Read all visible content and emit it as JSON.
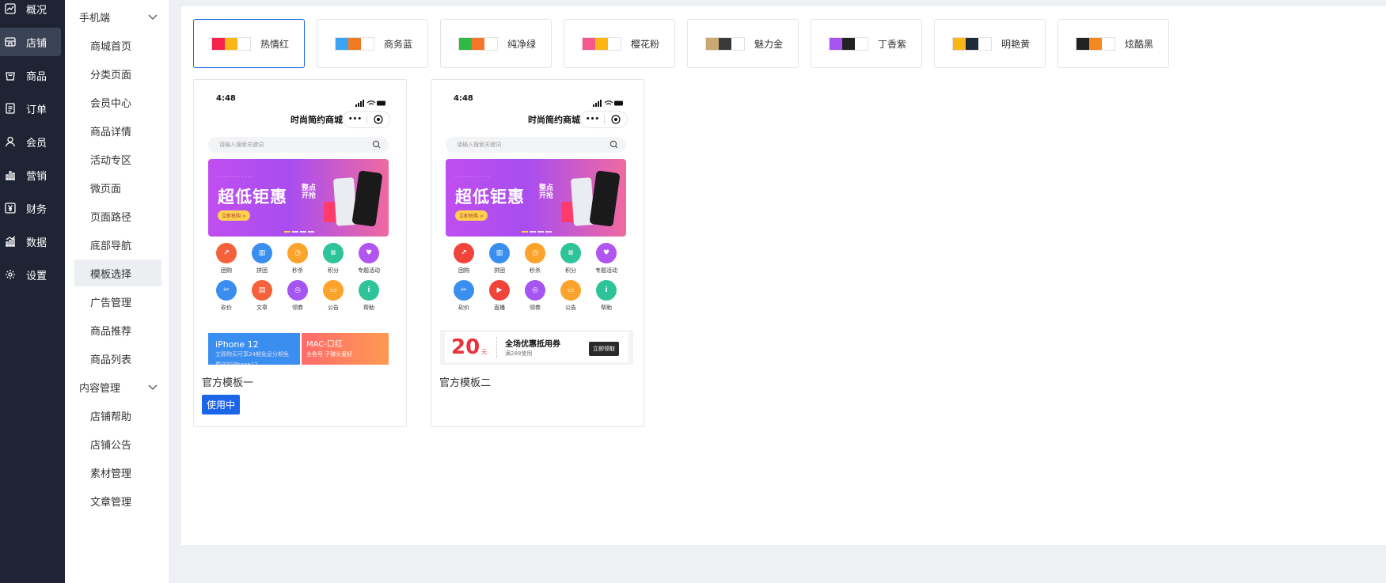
{
  "primary_nav": [
    {
      "label": "概况",
      "icon": "trend-icon",
      "active": false
    },
    {
      "label": "店铺",
      "icon": "store-icon",
      "active": true
    },
    {
      "label": "商品",
      "icon": "bag-icon",
      "active": false
    },
    {
      "label": "订单",
      "icon": "document-icon",
      "active": false
    },
    {
      "label": "会员",
      "icon": "user-icon",
      "active": false
    },
    {
      "label": "营销",
      "icon": "bar-chart-icon",
      "active": false
    },
    {
      "label": "财务",
      "icon": "yen-icon",
      "active": false
    },
    {
      "label": "数据",
      "icon": "analytics-icon",
      "active": false
    },
    {
      "label": "设置",
      "icon": "gear-icon",
      "active": false
    }
  ],
  "secondary_nav": {
    "group_mobile": "手机端",
    "mobile_items": [
      "商城首页",
      "分类页面",
      "会员中心",
      "商品详情",
      "活动专区",
      "微页面",
      "页面路径",
      "底部导航",
      "模板选择",
      "广告管理",
      "商品推荐",
      "商品列表"
    ],
    "active_item": "模板选择",
    "group_content": "内容管理",
    "content_items": [
      "店铺帮助",
      "店铺公告",
      "素材管理",
      "文章管理"
    ]
  },
  "color_themes": [
    {
      "name": "热情红",
      "colors": [
        "#f5234a",
        "#fbb515",
        "#ffffff"
      ],
      "selected": true
    },
    {
      "name": "商务蓝",
      "colors": [
        "#3aa3f4",
        "#f27a1e",
        "#ffffff"
      ],
      "selected": false
    },
    {
      "name": "纯净绿",
      "colors": [
        "#2fba45",
        "#f5762a",
        "#ffffff"
      ],
      "selected": false
    },
    {
      "name": "樱花粉",
      "colors": [
        "#f5588a",
        "#fbb515",
        "#ffffff"
      ],
      "selected": false
    },
    {
      "name": "魅力金",
      "colors": [
        "#c9a871",
        "#3a3a3a",
        "#ffffff"
      ],
      "selected": false
    },
    {
      "name": "丁香紫",
      "colors": [
        "#a455f2",
        "#222222",
        "#ffffff"
      ],
      "selected": false
    },
    {
      "name": "明艳黄",
      "colors": [
        "#fbb515",
        "#1f2a3a",
        "#ffffff"
      ],
      "selected": false
    },
    {
      "name": "炫酷黑",
      "colors": [
        "#222222",
        "#f5881e",
        "#ffffff"
      ],
      "selected": false
    }
  ],
  "templates": [
    {
      "name": "官方模板一",
      "badge": "使用中",
      "time": "4:48",
      "title": "时尚简约商城",
      "search_placeholder": "请输入搜索关键词",
      "banner_big": "超低钜惠",
      "banner_small": "整点开抢",
      "banner_tag": "立即抢购 >",
      "icons": [
        {
          "label": "团购",
          "color": "#f5613a",
          "glyph": "↗"
        },
        {
          "label": "拼团",
          "color": "#3a8ef0",
          "glyph": "▥"
        },
        {
          "label": "秒杀",
          "color": "#fba32a",
          "glyph": "◷"
        },
        {
          "label": "积分",
          "color": "#2fc39a",
          "glyph": "≡"
        },
        {
          "label": "专题活动",
          "color": "#b254f0",
          "glyph": "♥"
        },
        {
          "label": "砍价",
          "color": "#3a8ef0",
          "glyph": "✂"
        },
        {
          "label": "文章",
          "color": "#f5613a",
          "glyph": "▤"
        },
        {
          "label": "领券",
          "color": "#a455f2",
          "glyph": "◎"
        },
        {
          "label": "公告",
          "color": "#fba32a",
          "glyph": "▭"
        },
        {
          "label": "帮助",
          "color": "#2fc39a",
          "glyph": "i"
        }
      ],
      "promo_left": "iPhone 12",
      "promo_left_sub": "立即购买可享24期免息分期免费送的iPhone12",
      "promo_right": "MAC-口红",
      "promo_right_sub": "全色号 子弹头爱好"
    },
    {
      "name": "官方模板二",
      "time": "4:48",
      "title": "时尚简约商城",
      "search_placeholder": "请输入搜索关键词",
      "banner_big": "超低钜惠",
      "banner_small": "整点开抢",
      "banner_tag": "立即抢购 >",
      "icons": [
        {
          "label": "团购",
          "color": "#f0433a",
          "glyph": "↗"
        },
        {
          "label": "拼团",
          "color": "#3a8ef0",
          "glyph": "▥"
        },
        {
          "label": "秒杀",
          "color": "#fba32a",
          "glyph": "◷"
        },
        {
          "label": "积分",
          "color": "#2fc39a",
          "glyph": "≡"
        },
        {
          "label": "专题活动",
          "color": "#b254f0",
          "glyph": "♥"
        },
        {
          "label": "砍价",
          "color": "#3a8ef0",
          "glyph": "✂"
        },
        {
          "label": "直播",
          "color": "#f0433a",
          "glyph": "▶"
        },
        {
          "label": "领券",
          "color": "#a455f2",
          "glyph": "◎"
        },
        {
          "label": "公告",
          "color": "#fba32a",
          "glyph": "▭"
        },
        {
          "label": "帮助",
          "color": "#2fc39a",
          "glyph": "i"
        }
      ],
      "coupon_amount": "20",
      "coupon_unit": "元",
      "coupon_title": "全场优惠抵用券",
      "coupon_sub": "满288使用",
      "coupon_button": "立即领取"
    }
  ]
}
